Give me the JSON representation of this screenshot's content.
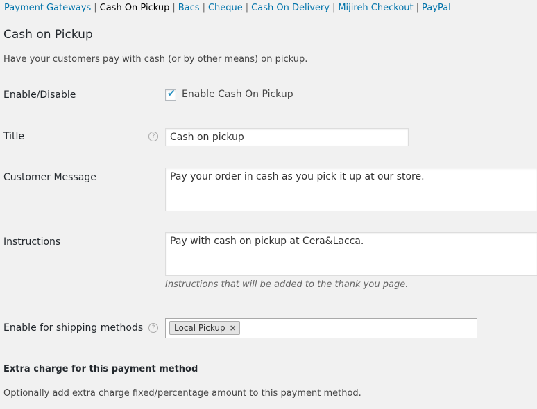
{
  "subnav": {
    "items": [
      {
        "label": "Payment Gateways",
        "current": false
      },
      {
        "label": "Cash On Pickup",
        "current": true
      },
      {
        "label": "Bacs",
        "current": false
      },
      {
        "label": "Cheque",
        "current": false
      },
      {
        "label": "Cash On Delivery",
        "current": false
      },
      {
        "label": "Mijireh Checkout",
        "current": false
      },
      {
        "label": "PayPal",
        "current": false
      }
    ],
    "separator": "|"
  },
  "page": {
    "title": "Cash on Pickup",
    "description": "Have your customers pay with cash (or by other means) on pickup."
  },
  "fields": {
    "enable": {
      "label": "Enable/Disable",
      "checkbox_label": "Enable Cash On Pickup",
      "checked": true
    },
    "title": {
      "label": "Title",
      "help_icon": "question-circle-icon",
      "value": "Cash on pickup"
    },
    "customer_message": {
      "label": "Customer Message",
      "value": "Pay your order in cash as you pick it up at our store."
    },
    "instructions": {
      "label": "Instructions",
      "value": "Pay with cash on pickup at Cera&Lacca.",
      "note": "Instructions that will be added to the thank you page."
    },
    "shipping_methods": {
      "label": "Enable for shipping methods",
      "help_icon": "question-circle-icon",
      "selected": [
        "Local Pickup"
      ],
      "remove_glyph": "×"
    }
  },
  "extra_charge": {
    "title": "Extra charge for this payment method",
    "description": "Optionally add extra charge fixed/percentage amount to this payment method."
  },
  "colors": {
    "link": "#0073aa",
    "background": "#f1f1f1",
    "checkmark": "#1e8cbe"
  }
}
